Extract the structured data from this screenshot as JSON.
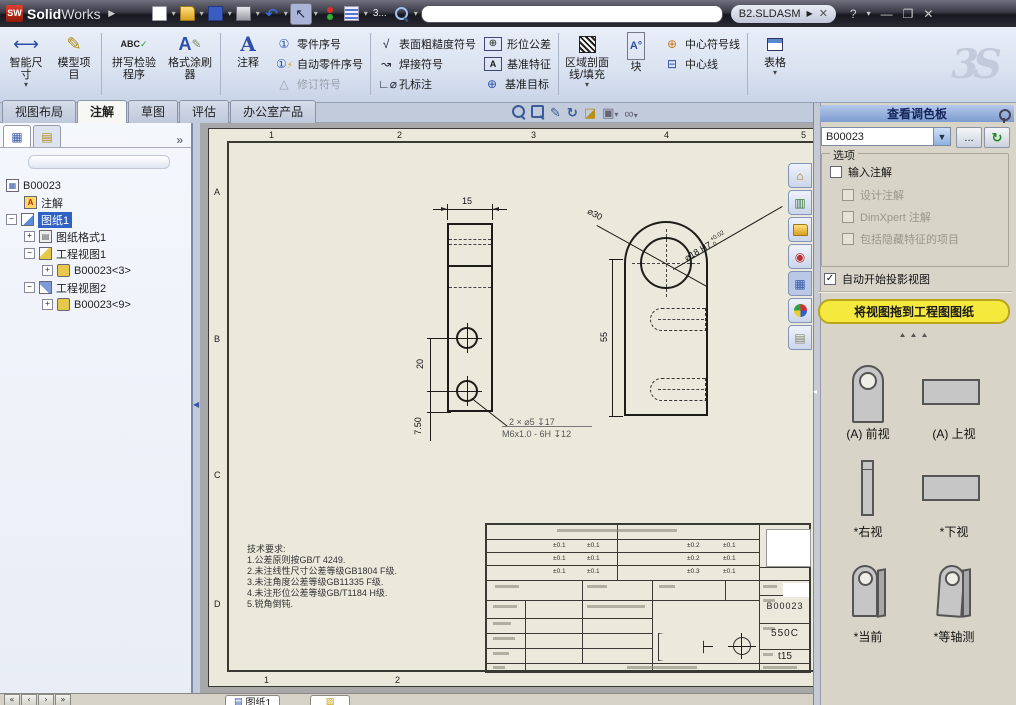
{
  "titlebar": {
    "logo_sw": "SW",
    "logo_solid": "Solid",
    "logo_works": "Works",
    "overflow_label": "3...",
    "doc_tab": "B2.SLDASM",
    "help": "?"
  },
  "tabs": [
    "视图布局",
    "注解",
    "草图",
    "评估",
    "办公室产品"
  ],
  "ribbon": {
    "smart_dimension": "智能尺寸",
    "model_items": "模型项目",
    "spell_checker": "拼写检验程序",
    "format_painter": "格式涂刷器",
    "note": "注释",
    "balloon": "零件序号",
    "auto_balloon": "自动零件序号",
    "revision_symbol": "修订符号",
    "surface_finish": "表面粗糙度符号",
    "weld_symbol": "焊接符号",
    "hole_callout": "孔标注",
    "geometric_tolerance": "形位公差",
    "datum_feature": "基准特征",
    "datum_target": "基准目标",
    "area_hatch": "区域剖面线/填充",
    "block": "块",
    "center_mark": "中心符号线",
    "centerline": "中心线",
    "tables": "表格",
    "watermark": "3S"
  },
  "tree": {
    "root": "B00023",
    "annotations": "注解",
    "sheet1": "图纸1",
    "sheet_format": "图纸格式1",
    "view1": "工程视图1",
    "view1_part": "B00023<3>",
    "view2": "工程视图2",
    "view2_part": "B00023<9>"
  },
  "palette": {
    "title": "查看调色板",
    "combo": "B00023",
    "browse": "...",
    "options": "选项",
    "import_annotations": "输入注解",
    "design_annotations": "设计注解",
    "dimxpert": "DimXpert 注解",
    "include_hidden": "包括隐藏特征的项目",
    "auto_start": "自动开始投影视图",
    "hint": "将视图拖到工程图图纸",
    "thumbs": [
      "(A) 前视",
      "(A) 上视",
      "*右视",
      "*下视",
      "*当前",
      "*等轴测"
    ]
  },
  "sheet": {
    "zones_top": [
      "1",
      "2",
      "3",
      "4",
      "5"
    ],
    "zones_bottom": [
      "1",
      "2"
    ],
    "zones_left": [
      "A",
      "B",
      "C",
      "D"
    ],
    "dims": {
      "w15": "15",
      "d20": "20",
      "d75": "7.50",
      "d55": "55",
      "dia30": "⌀30",
      "dia18": "⌀18 H7",
      "tol_up": "+0.02",
      "tol_dn": "0",
      "callout1": "2 × ⌀5 ↧17",
      "callout2": "M6x1.0 - 6H ↧12"
    },
    "notes": [
      "技术要求:",
      "1.公差原则按GB/T 4249.",
      "2.未注线性尺寸公差等级GB1804 F级.",
      "3.未注角度公差等级GB11335 F级.",
      "4.未注形位公差等级GB/T1184 H级.",
      "5.锐角倒钝."
    ],
    "titleblock": {
      "part_no": "B00023",
      "code": "550C",
      "thickness": "t15",
      "tol": [
        "±0.1",
        "±0.1",
        "±0.2",
        "±0.1",
        "±0.1",
        "±0.1",
        "±0.2",
        "±0.1",
        "±0.1",
        "±0.1",
        "±0.3",
        "±0.1"
      ]
    }
  },
  "statusbar": {
    "sheet_tab": "图纸1"
  }
}
